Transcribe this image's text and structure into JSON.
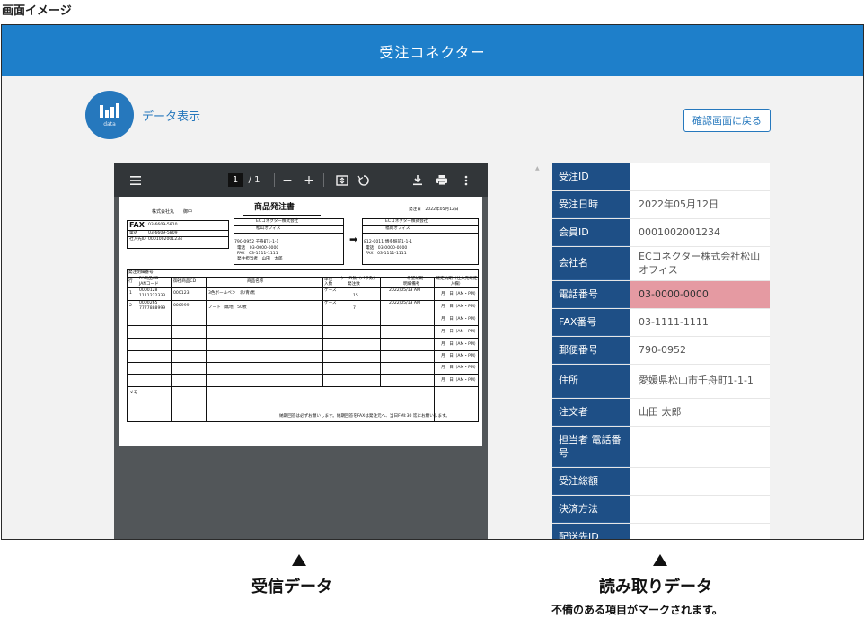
{
  "caption": {
    "title": "画面イメージ"
  },
  "app": {
    "title": "受注コネクター"
  },
  "section": {
    "title": "データ表示",
    "badge_icon": "bar-chart-icon",
    "badge_text": "data"
  },
  "actions": {
    "back_label": "確認画面に戻る"
  },
  "viewer": {
    "page_current": "1",
    "page_total": "/ 1",
    "zoom_out": "−",
    "zoom_in": "+",
    "document": {
      "title": "商品発注書",
      "to_line": "株式会社丸　　御中",
      "issued": "発注日　2022年05月12日",
      "fax_label": "FAX",
      "fax_value": "03-6609-5810",
      "tel_label": "電話",
      "tel_value": "03-6609-5809",
      "member_label": "社入先ID",
      "member_value": "0001002001234",
      "orderer_company": "ECコネクター株式会社",
      "orderer_office": "松山オフィス",
      "orderer_zip": "790-0952 千舟町1-1-1",
      "orderer_tel": "電話　03-0000-0000",
      "orderer_fax": "FAX　03-1111-1111",
      "orderer_person": "発注担当者　山田　太郎",
      "ship_company": "ECコネクター株式会社",
      "ship_office": "福岡オフィス",
      "ship_addr": "812-0011 博多駅前1-1-1",
      "ship_tel": "電話　03-0000-0000",
      "ship_fax": "FAX　03-1111-1111",
      "detail_label": "発注明細番号",
      "col_no": "行",
      "col_code": "PA商品CD",
      "col_jan": "JANコード",
      "col_sku": "御社商品CD",
      "col_name": "商品名称",
      "col_unit": "単位 入数",
      "col_case": "ケース数（バラ数）",
      "col_qty": "発注数",
      "col_due": "希望納期",
      "col_slip": "明細備考",
      "col_date": "確定納期（仕入先確定入欄）",
      "line1_code": "0000128",
      "line1_jan": "1111222333",
      "line1_sku": "000123",
      "line1_name": "3色ボールペン　赤/青/黒",
      "line1_unit": "ケース",
      "line1_qty": "15",
      "line1_due": "2022/05/13 AM",
      "line2_code": "0000265",
      "line2_jan": "7777888999",
      "line2_sku": "000999",
      "line2_name": "ノート（無地）50枚",
      "line2_unit": "ケース",
      "line2_qty": "7",
      "line2_due": "2022/05/13 AM",
      "date_cell": "月　日（AM・PM）",
      "memo_label": "メモ",
      "footer": "納期回答は必ずお願いします。納期回答をFAXは発注元へ、当日FMI:30 迄にお願いします。"
    }
  },
  "fields": [
    {
      "label": "受注ID",
      "value": "",
      "flagged": false
    },
    {
      "label": "受注日時",
      "value": "2022年05月12日",
      "flagged": false
    },
    {
      "label": "会員ID",
      "value": "0001002001234",
      "flagged": false
    },
    {
      "label": "会社名",
      "value": "ECコネクター株式会社松山オフィス",
      "flagged": false
    },
    {
      "label": "電話番号",
      "value": "03-0000-0000",
      "flagged": true
    },
    {
      "label": "FAX番号",
      "value": "03-1111-1111",
      "flagged": false
    },
    {
      "label": "郵便番号",
      "value": "790-0952",
      "flagged": false
    },
    {
      "label": "住所",
      "value": "愛媛県松山市千舟町1-1-1",
      "flagged": false
    },
    {
      "label": "注文者",
      "value": "山田 太郎",
      "flagged": false
    },
    {
      "label": "担当者 電話番号",
      "value": "",
      "flagged": false
    },
    {
      "label": "受注総額",
      "value": "",
      "flagged": false
    },
    {
      "label": "決済方法",
      "value": "",
      "flagged": false
    },
    {
      "label": "配送先ID",
      "value": "",
      "flagged": false
    }
  ],
  "captions": {
    "received": "受信データ",
    "parsed": "読み取りデータ",
    "parsed_note": "不備のある項目がマークされます。"
  },
  "colors": {
    "header": "#1e7fca",
    "label_bg": "#1e4f86",
    "flagged_bg": "#e59aa2"
  }
}
